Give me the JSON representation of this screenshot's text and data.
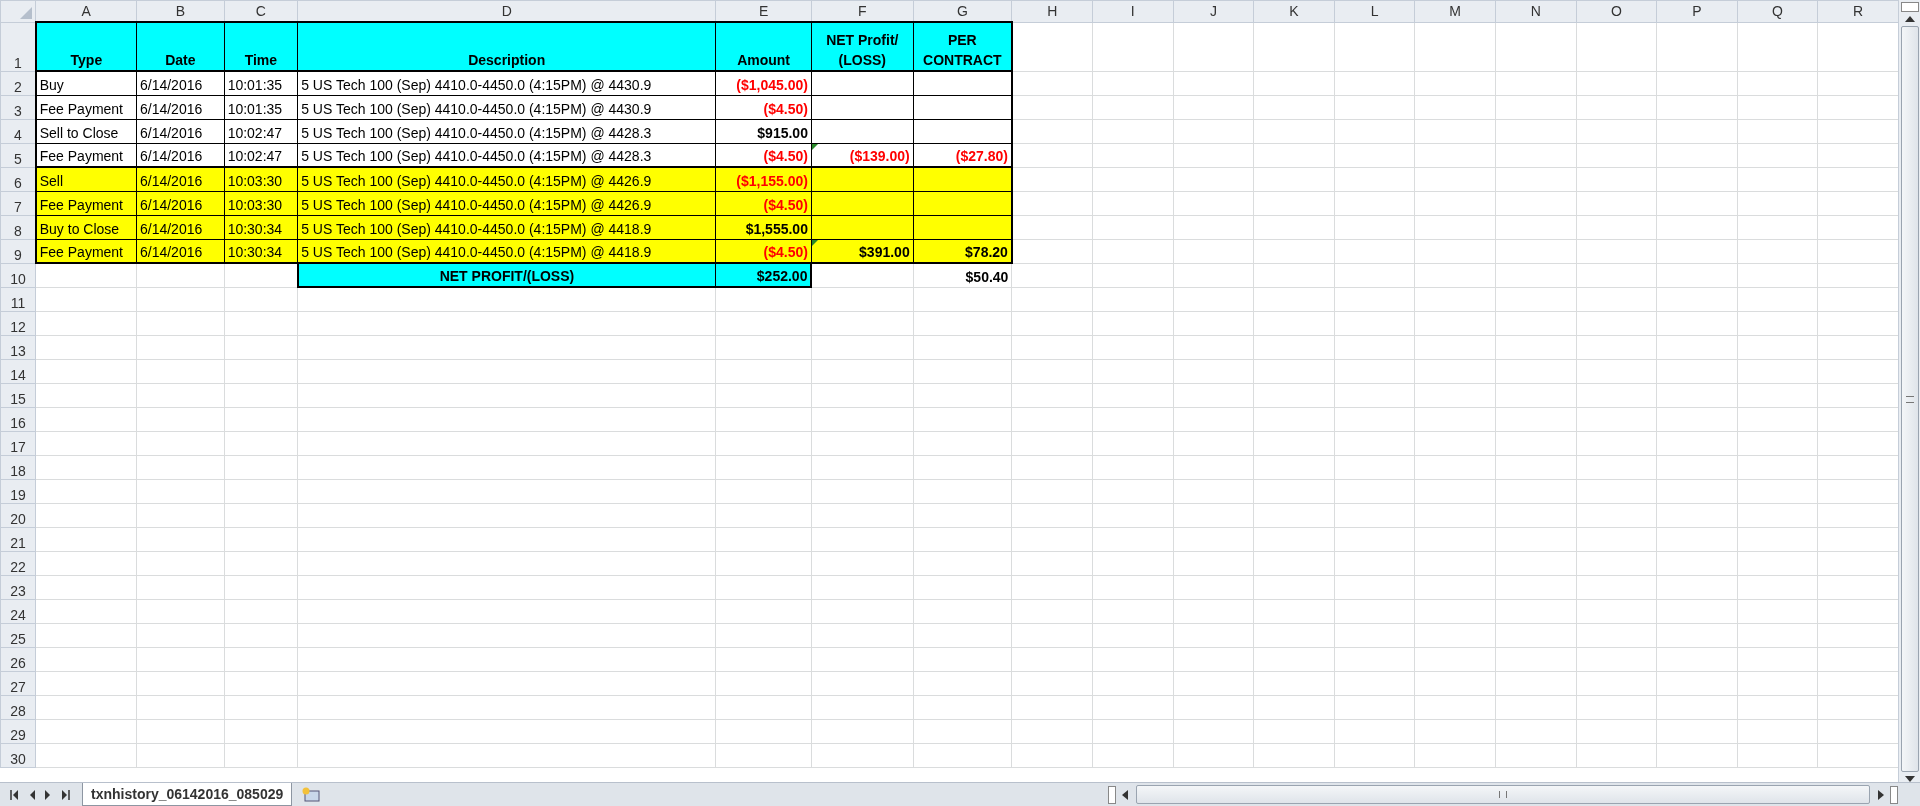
{
  "columns": [
    "A",
    "B",
    "C",
    "D",
    "E",
    "F",
    "G",
    "H",
    "I",
    "J",
    "K",
    "L",
    "M",
    "N",
    "O",
    "P",
    "Q",
    "R"
  ],
  "rows": [
    {
      "number": "1",
      "cells": [
        {
          "text": "Type",
          "color": "#00ffff"
        },
        {
          "text": "Date",
          "color": "#00ffff"
        },
        {
          "text": "Time",
          "color": "#00ffff"
        },
        {
          "text": "Description",
          "color": "#00ffff"
        },
        {
          "text": "Amount",
          "color": "#00ffff"
        },
        {
          "text": "NET Profit/ (LOSS)",
          "color": "#00ffff"
        },
        {
          "text": "PER CONTRACT",
          "color": "#00ffff"
        }
      ]
    },
    {
      "number": "2",
      "cells": [
        {
          "text": "Buy",
          "color": "#ffffff"
        },
        {
          "text": "6/14/2016",
          "color": "#ffffff"
        },
        {
          "text": "10:01:35",
          "color": "#ffffff"
        },
        {
          "text": "5 US Tech 100 (Sep) 4410.0-4450.0 (4:15PM) @ 4430.9",
          "color": "#ffffff"
        },
        {
          "text": "($1,045.00)",
          "color": "#ffffff",
          "negative": true
        },
        {
          "color": "#ffffff"
        },
        {
          "color": "#ffffff"
        }
      ]
    },
    {
      "number": "3",
      "cells": [
        {
          "text": "Fee Payment",
          "color": "#ffffff"
        },
        {
          "text": "6/14/2016",
          "color": "#ffffff"
        },
        {
          "text": "10:01:35",
          "color": "#ffffff"
        },
        {
          "text": "5 US Tech 100 (Sep) 4410.0-4450.0 (4:15PM) @ 4430.9",
          "color": "#ffffff"
        },
        {
          "text": "($4.50)",
          "color": "#ffffff",
          "negative": true
        },
        {
          "color": "#ffffff"
        },
        {
          "color": "#ffffff"
        }
      ]
    },
    {
      "number": "4",
      "cells": [
        {
          "text": "Sell to Close",
          "color": "#ffffff"
        },
        {
          "text": "6/14/2016",
          "color": "#ffffff"
        },
        {
          "text": "10:02:47",
          "color": "#ffffff"
        },
        {
          "text": "5 US Tech 100 (Sep) 4410.0-4450.0 (4:15PM) @ 4428.3",
          "color": "#ffffff"
        },
        {
          "text": "$915.00",
          "color": "#ffffff",
          "negative": false
        },
        {
          "color": "#ffffff"
        },
        {
          "color": "#ffffff"
        }
      ]
    },
    {
      "number": "5",
      "cells": [
        {
          "text": "Fee Payment",
          "color": "#ffffff"
        },
        {
          "text": "6/14/2016",
          "color": "#ffffff"
        },
        {
          "text": "10:02:47",
          "color": "#ffffff"
        },
        {
          "text": "5 US Tech 100 (Sep) 4410.0-4450.0 (4:15PM) @ 4428.3",
          "color": "#ffffff"
        },
        {
          "text": "($4.50)",
          "color": "#ffffff",
          "negative": true
        },
        {
          "text": "($139.00)",
          "color": "#ffffff",
          "negative": true,
          "flagged": true
        },
        {
          "text": "($27.80)",
          "color": "#ffffff",
          "negative": true
        }
      ]
    },
    {
      "number": "6",
      "cells": [
        {
          "text": "Sell",
          "color": "#ffff00"
        },
        {
          "text": "6/14/2016",
          "color": "#ffff00"
        },
        {
          "text": "10:03:30",
          "color": "#ffff00"
        },
        {
          "text": "5 US Tech 100 (Sep) 4410.0-4450.0 (4:15PM) @ 4426.9",
          "color": "#ffff00"
        },
        {
          "text": "($1,155.00)",
          "color": "#ffff00",
          "negative": true
        },
        {
          "color": "#ffff00"
        },
        {
          "color": "#ffff00"
        }
      ]
    },
    {
      "number": "7",
      "cells": [
        {
          "text": "Fee Payment",
          "color": "#ffff00"
        },
        {
          "text": "6/14/2016",
          "color": "#ffff00"
        },
        {
          "text": "10:03:30",
          "color": "#ffff00"
        },
        {
          "text": "5 US Tech 100 (Sep) 4410.0-4450.0 (4:15PM) @ 4426.9",
          "color": "#ffff00"
        },
        {
          "text": "($4.50)",
          "color": "#ffff00",
          "negative": true
        },
        {
          "color": "#ffff00"
        },
        {
          "color": "#ffff00"
        }
      ]
    },
    {
      "number": "8",
      "cells": [
        {
          "text": "Buy to Close",
          "color": "#ffff00"
        },
        {
          "text": "6/14/2016",
          "color": "#ffff00"
        },
        {
          "text": "10:30:34",
          "color": "#ffff00"
        },
        {
          "text": "5 US Tech 100 (Sep) 4410.0-4450.0 (4:15PM) @ 4418.9",
          "color": "#ffff00"
        },
        {
          "text": "$1,555.00",
          "color": "#ffff00",
          "negative": false
        },
        {
          "color": "#ffff00"
        },
        {
          "color": "#ffff00"
        }
      ]
    },
    {
      "number": "9",
      "cells": [
        {
          "text": "Fee Payment",
          "color": "#ffff00"
        },
        {
          "text": "6/14/2016",
          "color": "#ffff00"
        },
        {
          "text": "10:30:34",
          "color": "#ffff00"
        },
        {
          "text": "5 US Tech 100 (Sep) 4410.0-4450.0 (4:15PM) @ 4418.9",
          "color": "#ffff00"
        },
        {
          "text": "($4.50)",
          "color": "#ffff00",
          "negative": true
        },
        {
          "text": "$391.00",
          "color": "#ffff00",
          "negative": false,
          "flagged": true
        },
        {
          "text": "$78.20",
          "color": "#ffff00",
          "negative": false
        }
      ]
    },
    {
      "number": "10",
      "cells": [
        {},
        {},
        {},
        {
          "text": "NET PROFIT/(LOSS)",
          "color": "#00ffff"
        },
        {
          "text": "$252.00",
          "color": "#00ffff",
          "negative": false
        },
        {},
        {
          "text": "$50.40",
          "negative": false
        }
      ]
    }
  ],
  "empty_rows": [
    "11",
    "12",
    "13",
    "14",
    "15",
    "16",
    "17",
    "18",
    "19",
    "20",
    "21",
    "22",
    "23",
    "24",
    "25",
    "26",
    "27",
    "28",
    "29",
    "30"
  ],
  "sheet_tabs": [
    {
      "label": "txnhistory_06142016_085029",
      "selected": true
    }
  ]
}
